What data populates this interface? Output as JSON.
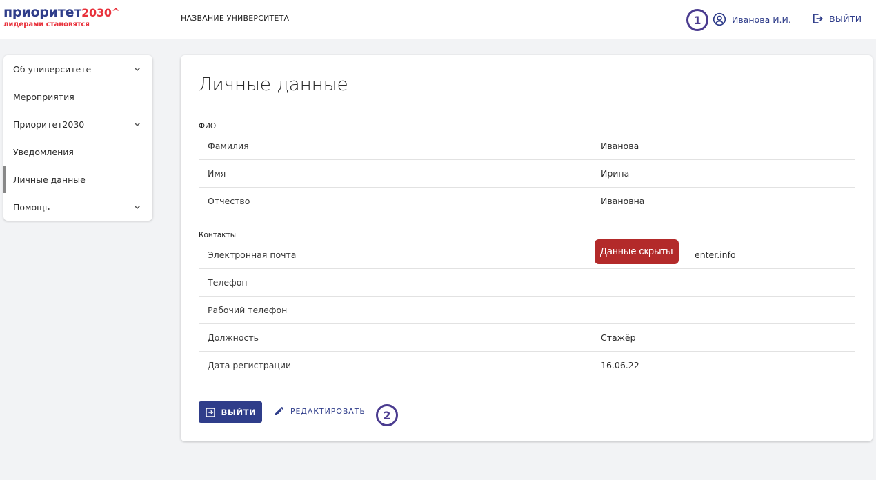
{
  "logo": {
    "main": "приоритет",
    "number": "2030",
    "caret": "^",
    "tagline": "лидерами становятся"
  },
  "header": {
    "university": "НАЗВАНИЕ УНИВЕРСИТЕТА",
    "user_name": "Иванова И.И.",
    "logout_label": "ВЫЙТИ",
    "user_icon": "user-circle-icon",
    "logout_icon": "logout-icon"
  },
  "markers": {
    "one": "1",
    "two": "2"
  },
  "sidebar": {
    "items": [
      {
        "label": "Об университете",
        "expandable": true
      },
      {
        "label": "Мероприятия",
        "expandable": false
      },
      {
        "label": "Приоритет2030",
        "expandable": true
      },
      {
        "label": "Уведомления",
        "expandable": false
      },
      {
        "label": "Личные данные",
        "expandable": false,
        "active": true
      },
      {
        "label": "Помощь",
        "expandable": true
      }
    ]
  },
  "main": {
    "title": "Личные данные",
    "fio": {
      "label": "ФИО",
      "rows": [
        {
          "key": "Фамилия",
          "value": "Иванова"
        },
        {
          "key": "Имя",
          "value": "Ирина"
        },
        {
          "key": "Отчество",
          "value": "Ивановна"
        }
      ]
    },
    "contacts": {
      "label": "Контакты",
      "rows": [
        {
          "key": "Электронная почта",
          "value": "enter.info"
        },
        {
          "key": "Телефон",
          "value": ""
        },
        {
          "key": "Рабочий телефон",
          "value": ""
        },
        {
          "key": "Должность",
          "value": "Стажёр"
        },
        {
          "key": "Дата регистрации",
          "value": "16.06.22"
        }
      ]
    },
    "hidden_badge": "Данные скрыты",
    "logout_button": "ВЫЙТИ",
    "edit_button": "РЕДАКТИРОВАТЬ"
  },
  "colors": {
    "brand": "#2f3d8a",
    "accent_red": "#e8313b",
    "badge_red": "#b32a2a",
    "marker": "#4a3b8f"
  }
}
